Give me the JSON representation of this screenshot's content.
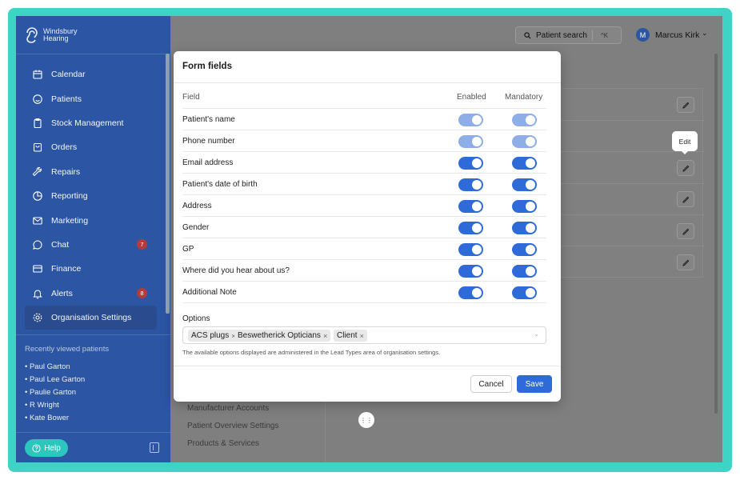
{
  "app": {
    "brand_line1": "Windsbury",
    "brand_line2": "Hearing"
  },
  "colors": {
    "frame": "#3fd3c6",
    "sidebar": "#2c56a3",
    "accent": "#2e6bd9",
    "badge": "#b63a39",
    "help": "#2bc6bd"
  },
  "sidebar": {
    "items": [
      {
        "label": "Calendar",
        "icon": "calendar-icon"
      },
      {
        "label": "Patients",
        "icon": "smiley-icon"
      },
      {
        "label": "Stock Management",
        "icon": "clipboard-icon"
      },
      {
        "label": "Orders",
        "icon": "bag-icon"
      },
      {
        "label": "Repairs",
        "icon": "wrench-icon"
      },
      {
        "label": "Reporting",
        "icon": "pie-chart-icon"
      },
      {
        "label": "Marketing",
        "icon": "mail-icon"
      },
      {
        "label": "Chat",
        "icon": "chat-icon",
        "badge": "7"
      },
      {
        "label": "Finance",
        "icon": "card-icon"
      },
      {
        "label": "Alerts",
        "icon": "bell-icon",
        "badge": "8"
      },
      {
        "label": "Organisation Settings",
        "icon": "gear-icon",
        "active": true
      }
    ],
    "recent_title": "Recently viewed patients",
    "recent": [
      "Paul Garton",
      "Paul Lee Garton",
      "Paulie Garton",
      "R Wright",
      "Kate Bower"
    ],
    "help_label": "Help"
  },
  "header": {
    "search_label": "Patient search",
    "search_shortcut": "^K",
    "avatar_initial": "M",
    "user_name": "Marcus Kirk"
  },
  "background": {
    "tooltip": "Edit",
    "settings_items": [
      "Manufacturer Accounts",
      "Patient Overview Settings",
      "Products & Services"
    ]
  },
  "modal": {
    "title": "Form fields",
    "col_field": "Field",
    "col_enabled": "Enabled",
    "col_mandatory": "Mandatory",
    "rows": [
      {
        "label": "Patient's name",
        "enabled": true,
        "mandatory": true,
        "locked": true
      },
      {
        "label": "Phone number",
        "enabled": true,
        "mandatory": true,
        "locked": true
      },
      {
        "label": "Email address",
        "enabled": true,
        "mandatory": true,
        "locked": false
      },
      {
        "label": "Patient's date of birth",
        "enabled": true,
        "mandatory": true,
        "locked": false
      },
      {
        "label": "Address",
        "enabled": true,
        "mandatory": true,
        "locked": false
      },
      {
        "label": "Gender",
        "enabled": true,
        "mandatory": true,
        "locked": false
      },
      {
        "label": "GP",
        "enabled": true,
        "mandatory": true,
        "locked": false
      },
      {
        "label": "Where did you hear about us?",
        "enabled": true,
        "mandatory": true,
        "locked": false
      },
      {
        "label": "Additional Note",
        "enabled": true,
        "mandatory": true,
        "locked": false
      }
    ],
    "options_label": "Options",
    "options": [
      "ACS plugs",
      "Beswetherick Opticians",
      "Client"
    ],
    "options_help": "The available options displayed are administered in the Lead Types area of organisation settings.",
    "cancel_label": "Cancel",
    "save_label": "Save"
  }
}
